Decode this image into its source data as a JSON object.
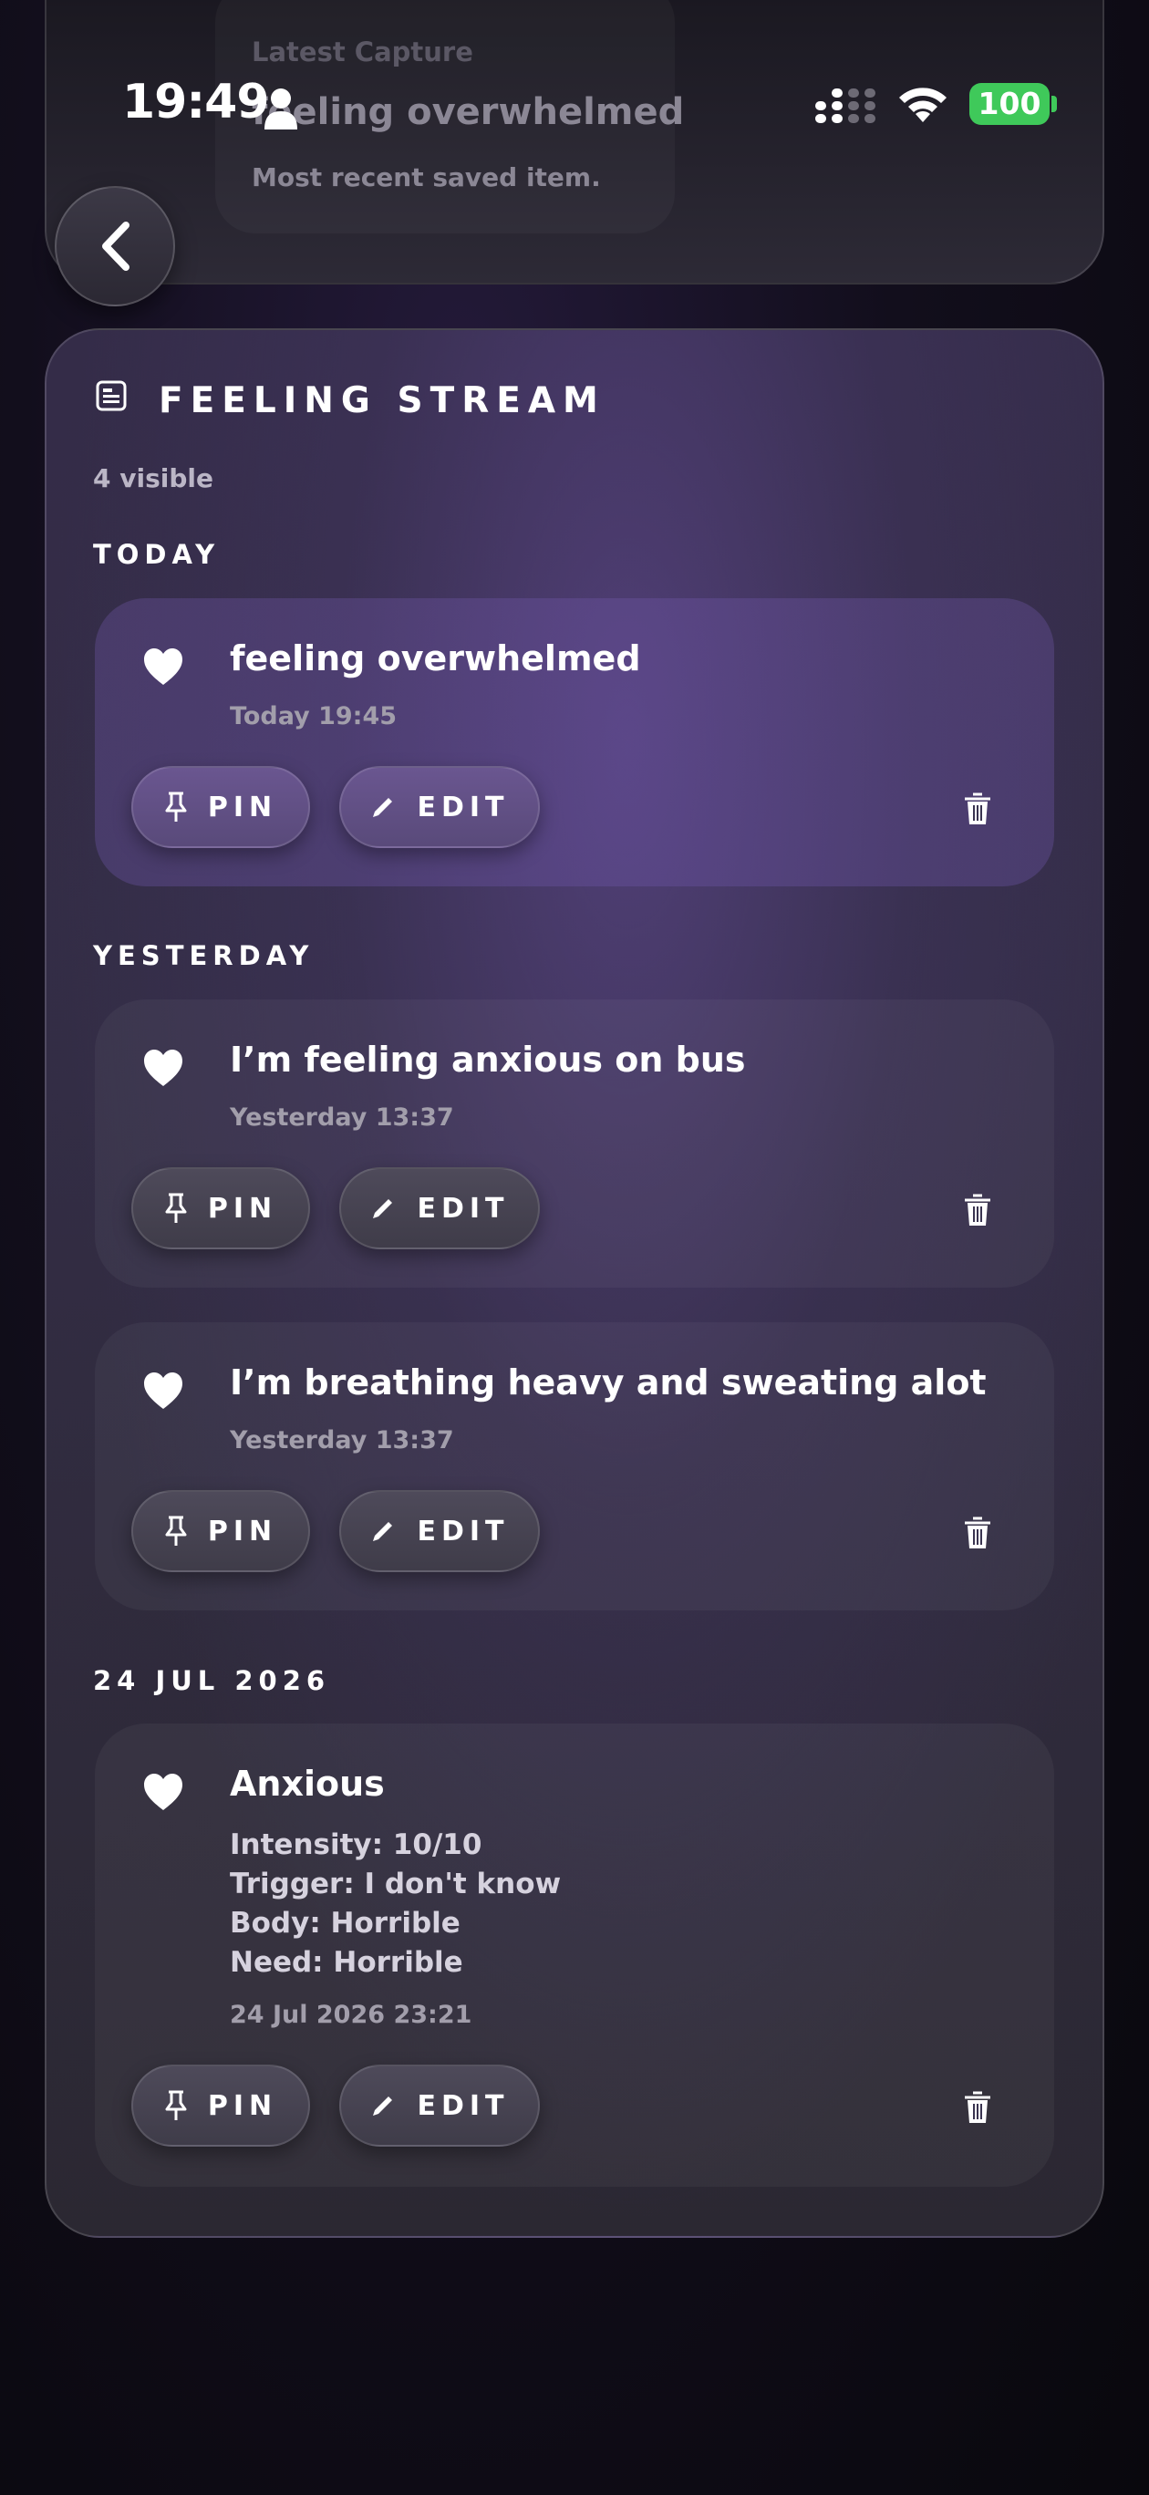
{
  "status_bar": {
    "time": "19:49",
    "battery": "100"
  },
  "latest_capture": {
    "label": "Latest Capture",
    "title": "feeling overwhelmed",
    "subtitle": "Most recent saved item."
  },
  "stream": {
    "title": "FEELING STREAM",
    "visible_count": "4 visible",
    "pin_label": "PIN",
    "edit_label": "EDIT",
    "sections": [
      {
        "label": "TODAY"
      },
      {
        "label": "YESTERDAY"
      },
      {
        "label": "24 JUL 2026"
      }
    ],
    "entries": [
      {
        "title": "feeling overwhelmed",
        "time": "Today 19:45"
      },
      {
        "title": "I’m feeling anxious on bus",
        "time": "Yesterday 13:37"
      },
      {
        "title": "I’m breathing heavy and sweating alot",
        "time": "Yesterday 13:37"
      },
      {
        "title": "Anxious",
        "details": [
          "Intensity: 10/10",
          "Trigger: I don't know",
          "Body: Horrible",
          "Need: Horrible"
        ],
        "time": "24 Jul 2026 23:21"
      }
    ]
  },
  "colors": {
    "accent": "#6a5690",
    "battery": "#3fc95a",
    "background": "#0b0a10"
  }
}
